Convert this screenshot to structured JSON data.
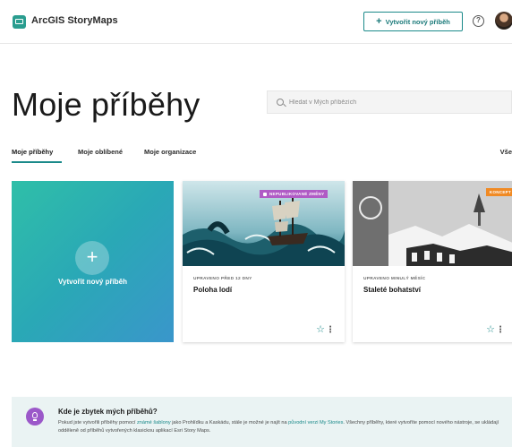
{
  "header": {
    "app_name": "ArcGIS StoryMaps",
    "create_button": "Vytvořit nový příběh",
    "help_icon": "?"
  },
  "page": {
    "title": "Moje příběhy"
  },
  "search": {
    "placeholder": "Hledat v Mých příbězích"
  },
  "tabs": [
    {
      "label": "Moje příběhy",
      "active": true
    },
    {
      "label": "Moje oblíbené",
      "active": false
    },
    {
      "label": "Moje organizace",
      "active": false
    }
  ],
  "view_all": "Vše",
  "create_card": {
    "label": "Vytvořit nový příběh"
  },
  "stories": [
    {
      "badge": "NEPUBLIKOVANÉ ZMĚNY",
      "meta": "UPRAVENO PŘED 12 DNY",
      "title": "Poloha lodí"
    },
    {
      "badge": "KONCEPT",
      "meta": "UPRAVENO MINULÝ MĚSÍC",
      "title": "Staleté bohatství"
    }
  ],
  "notice": {
    "title": "Kde je zbytek mých příběhů?",
    "text_1": "Pokud jste vytvořili příběhy pomocí",
    "link_1": "známé šablony",
    "text_2": "jako Prohlídku a Kaskádu, stále je možné je najít na",
    "link_2": "původní verzi My Stories",
    "text_3": ". Všechny příběhy, které vytvoříte pomocí nového nástroje, se ukládají odděleně od příběhů vytvořených klasickou aplikací Esri Story Maps."
  },
  "colors": {
    "accent": "#1b8a8a",
    "create_card_gradient": [
      "#2fbfa8",
      "#3a96cb"
    ],
    "badge_unpublished": "#b05bc5",
    "badge_draft": "#f08a24",
    "notice_bg": "#eaf3f3"
  }
}
